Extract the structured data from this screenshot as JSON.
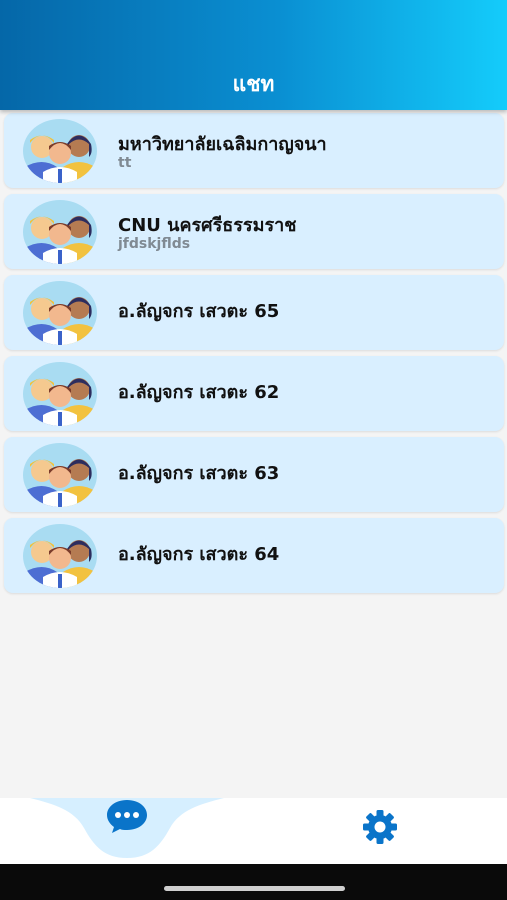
{
  "header": {
    "title": "แชท"
  },
  "chats": [
    {
      "name": "มหาวิทยาลัยเฉลิมกาญจนา",
      "preview": "tt"
    },
    {
      "name": "CNU นครศรีธรรมราช",
      "preview": "jfdskjflds"
    },
    {
      "name": "อ.ลัญจกร เสวตะ 65",
      "preview": ""
    },
    {
      "name": "อ.ลัญจกร เสวตะ 62",
      "preview": ""
    },
    {
      "name": "อ.ลัญจกร เสวตะ 63",
      "preview": ""
    },
    {
      "name": "อ.ลัญจกร เสวตะ 64",
      "preview": ""
    }
  ],
  "bottom_nav": {
    "active_tab": "chat",
    "tabs": [
      {
        "id": "chat",
        "icon": "chat-bubble-icon"
      },
      {
        "id": "settings",
        "icon": "gear-icon"
      }
    ]
  },
  "colors": {
    "header_start": "#0567a8",
    "header_end": "#14ccfb",
    "item_bg": "#d9efff",
    "accent": "#0a74c9"
  }
}
